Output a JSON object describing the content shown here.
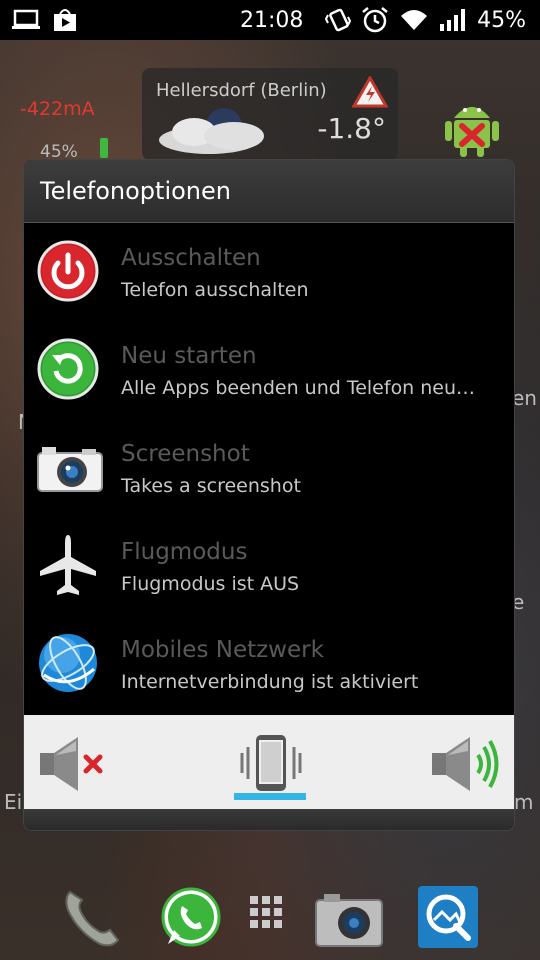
{
  "status_bar": {
    "time": "21:08",
    "battery_pct": "45%",
    "icons_left": [
      "laptop-icon",
      "play-store-icon"
    ],
    "icons_right": [
      "vibrate-icon",
      "alarm-icon",
      "wifi-icon",
      "signal-icon"
    ]
  },
  "background": {
    "current_widget": {
      "value": "-422mA",
      "percent": "45%"
    },
    "weather": {
      "city": "Hellersdorf (Berlin)",
      "temp": "-1.8°"
    },
    "edge_fragments": [
      "en",
      "e",
      "Ei",
      "m",
      "N"
    ]
  },
  "dialog": {
    "title": "Telefonoptionen",
    "options": [
      {
        "title": "Ausschalten",
        "subtitle": "Telefon ausschalten",
        "icon": "power-icon"
      },
      {
        "title": "Neu starten",
        "subtitle": "Alle Apps beenden und Telefon neu…",
        "icon": "restart-icon"
      },
      {
        "title": "Screenshot",
        "subtitle": "Takes a screenshot",
        "icon": "camera-icon"
      },
      {
        "title": "Flugmodus",
        "subtitle": "Flugmodus ist AUS",
        "icon": "airplane-icon"
      },
      {
        "title": "Mobiles Netzwerk",
        "subtitle": "Internetverbindung ist aktiviert",
        "icon": "globe-icon"
      }
    ],
    "sound_modes": [
      {
        "name": "silent",
        "icon": "speaker-muted-icon"
      },
      {
        "name": "vibrate",
        "icon": "vibrate-phone-icon",
        "selected": true
      },
      {
        "name": "sound",
        "icon": "speaker-on-icon"
      }
    ]
  },
  "dock": [
    "phone-icon",
    "whatsapp-icon",
    "app-drawer-icon",
    "camera-app-icon",
    "gallery-icon"
  ],
  "colors": {
    "accent": "#33b5e5",
    "power": "#d9262d",
    "restart": "#3bb53b"
  }
}
